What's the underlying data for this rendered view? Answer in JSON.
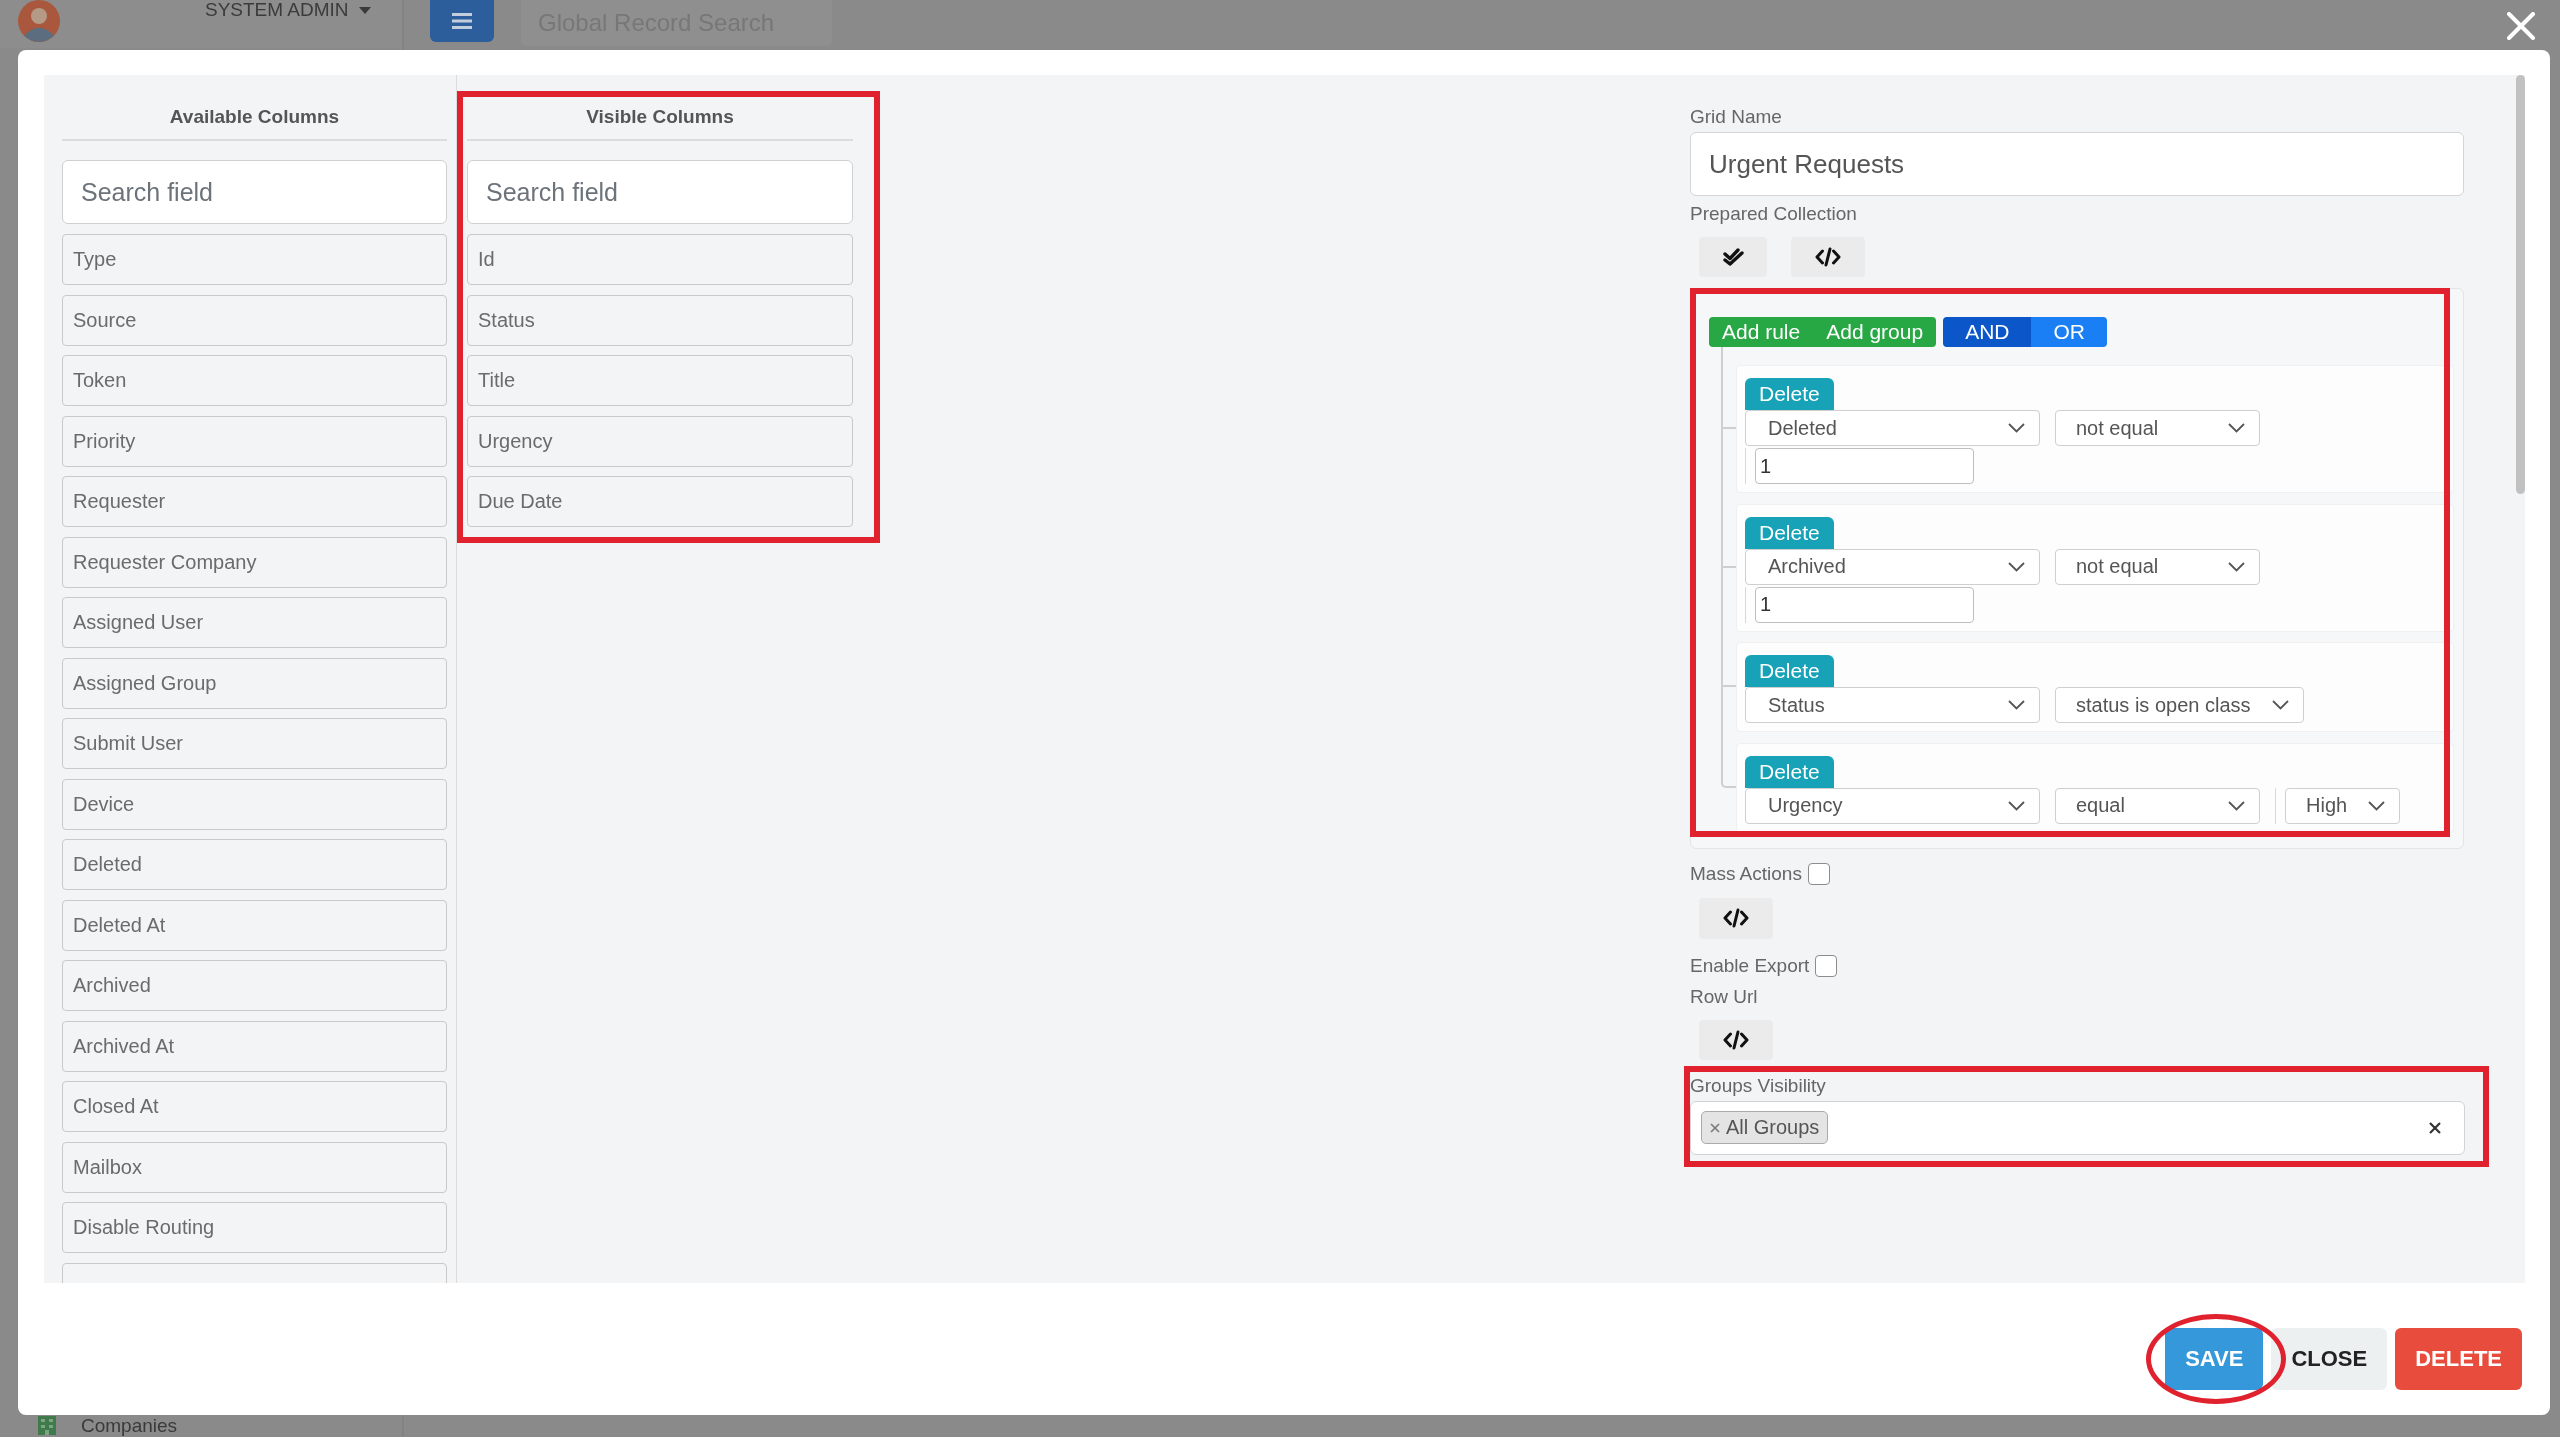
{
  "app_bar": {
    "user_name": "SYSTEM ADMIN",
    "search": {
      "placeholder": "Global Record Search"
    }
  },
  "sidebar": {
    "items": [
      {
        "label": "Companies"
      }
    ]
  },
  "dialog": {
    "available_columns": {
      "title": "Available Columns",
      "search": {
        "placeholder": "Search field"
      },
      "items": [
        "Type",
        "Source",
        "Token",
        "Priority",
        "Requester",
        "Requester Company",
        "Assigned User",
        "Assigned Group",
        "Submit User",
        "Device",
        "Deleted",
        "Deleted At",
        "Archived",
        "Archived At",
        "Closed At",
        "Mailbox",
        "Disable Routing"
      ],
      "has_more": true
    },
    "visible_columns": {
      "title": "Visible Columns",
      "highlighted": true,
      "search": {
        "placeholder": "Search field"
      },
      "items": [
        "Id",
        "Status",
        "Title",
        "Urgency",
        "Due Date"
      ]
    },
    "grid_name": {
      "label": "Grid Name",
      "value": "Urgent Requests"
    },
    "prepared_collection": {
      "label": "Prepared Collection"
    },
    "query_builder": {
      "highlighted": true,
      "actions": [
        {
          "label": "Add rule"
        },
        {
          "label": "Add group"
        }
      ],
      "conditions": [
        {
          "label": "AND",
          "selected": true
        },
        {
          "label": "OR",
          "selected": false
        }
      ],
      "rules": [
        {
          "delete_label": "Delete",
          "field": "Deleted",
          "operator": "not equal",
          "value": {
            "kind": "input",
            "text": "1"
          }
        },
        {
          "delete_label": "Delete",
          "field": "Archived",
          "operator": "not equal",
          "value": {
            "kind": "input",
            "text": "1"
          }
        },
        {
          "delete_label": "Delete",
          "field": "Status",
          "operator": "status is open class"
        },
        {
          "delete_label": "Delete",
          "field": "Urgency",
          "operator": "equal",
          "value": {
            "kind": "select",
            "text": "High"
          }
        }
      ]
    },
    "mass_actions": {
      "label": "Mass Actions",
      "checked": false
    },
    "enable_export": {
      "label": "Enable Export",
      "checked": false
    },
    "row_url": {
      "label": "Row Url"
    },
    "groups_visibility": {
      "label": "Groups Visibility",
      "highlighted": true,
      "tags": [
        {
          "label": "All Groups"
        }
      ]
    },
    "buttons": [
      {
        "label": "SAVE",
        "kind": "primary",
        "highlighted": true
      },
      {
        "label": "CLOSE",
        "kind": "secondary",
        "highlighted": false
      },
      {
        "label": "DELETE",
        "kind": "danger",
        "highlighted": false
      }
    ]
  }
}
